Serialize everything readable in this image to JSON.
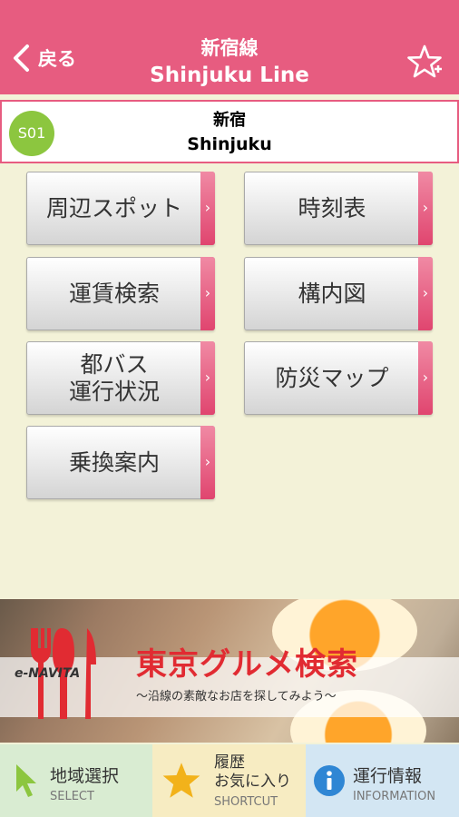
{
  "header": {
    "back_label": "戻る",
    "title_jp": "新宿線",
    "title_en": "Shinjuku Line"
  },
  "station": {
    "code": "S01",
    "name_jp": "新宿",
    "name_en": "Shinjuku"
  },
  "menu": {
    "nearby_spots": "周辺スポット",
    "timetable": "時刻表",
    "fare_search": "運賃検索",
    "station_map": "構内図",
    "bus_status": "都バス\n運行状況",
    "disaster_map": "防災マップ",
    "transfer_guide": "乗換案内"
  },
  "banner": {
    "logo": "e-NAVITA",
    "title": "東京グルメ検索",
    "subtitle": "～沿線の素敵なお店を探してみよう～"
  },
  "tabs": {
    "select_jp": "地域選択",
    "select_en": "SELECT",
    "shortcut_jp_1": "履歴",
    "shortcut_jp_2": "お気に入り",
    "shortcut_en": "SHORTCUT",
    "info_jp": "運行情報",
    "info_en": "INFORMATION"
  },
  "colors": {
    "header": "#e75c80",
    "background": "#f3f2d8",
    "station_badge": "#8cc63f",
    "banner_title": "#e12b32"
  }
}
